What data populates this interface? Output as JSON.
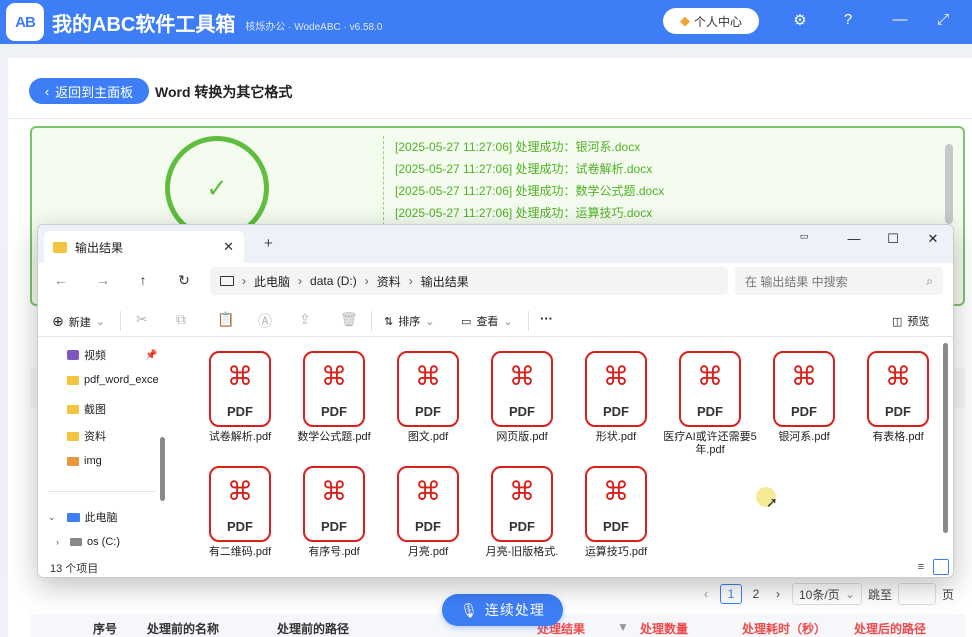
{
  "app": {
    "logo_text": "AB",
    "title": "我的ABC软件工具箱",
    "subtitle": "核烁办公 · WodeABC · v6.58.0",
    "user_center_label": "个人中心"
  },
  "page": {
    "back_label": "返回到主面板",
    "title": "Word 转换为其它格式"
  },
  "log_lines": [
    "[2025-05-27 11:27:06] 处理成功：银河系.docx",
    "[2025-05-27 11:27:06] 处理成功：试卷解析.docx",
    "[2025-05-27 11:27:06] 处理成功：数学公式题.docx",
    "[2025-05-27 11:27:06] 处理成功：运算技巧.docx"
  ],
  "explorer": {
    "tab_title": "输出结果",
    "breadcrumb": [
      "此电脑",
      "data (D:)",
      "资料",
      "输出结果"
    ],
    "search_placeholder": "在 输出结果 中搜索",
    "toolbar": {
      "new_label": "新建",
      "sort_label": "排序",
      "view_label": "查看",
      "more_label": "···",
      "preview_label": "预览"
    },
    "sidebar": [
      {
        "label": "视频"
      },
      {
        "label": "pdf_word_exce"
      },
      {
        "label": "截图"
      },
      {
        "label": "资料"
      },
      {
        "label": "img"
      },
      {
        "label": "此电脑"
      },
      {
        "label": "os (C:)"
      }
    ],
    "file_type_label": "PDF",
    "files": [
      {
        "name": "试卷解析.pdf"
      },
      {
        "name": "数学公式题.pdf"
      },
      {
        "name": "图文.pdf"
      },
      {
        "name": "网页版.pdf"
      },
      {
        "name": "形状.pdf"
      },
      {
        "name": "医疗AI或许还需要5年.pdf"
      },
      {
        "name": "银河系.pdf"
      },
      {
        "name": "有表格.pdf"
      },
      {
        "name": "有二维码.pdf"
      },
      {
        "name": "有序号.pdf"
      },
      {
        "name": "月亮.pdf"
      },
      {
        "name": "月亮-旧版格式."
      },
      {
        "name": "运算技巧.pdf"
      }
    ],
    "status": "13 个项目"
  },
  "pager": {
    "current": "1",
    "next": "2",
    "page_size": "10条/页",
    "jump_label": "跳至",
    "page_unit": "页"
  },
  "run_button_label": "连续处理",
  "table_headers": {
    "index": "序号",
    "name_before": "处理前的名称",
    "path_before": "处理前的路径",
    "result": "处理结果",
    "count": "处理数量",
    "time": "处理耗时（秒）",
    "path_after": "处理后的路径"
  }
}
